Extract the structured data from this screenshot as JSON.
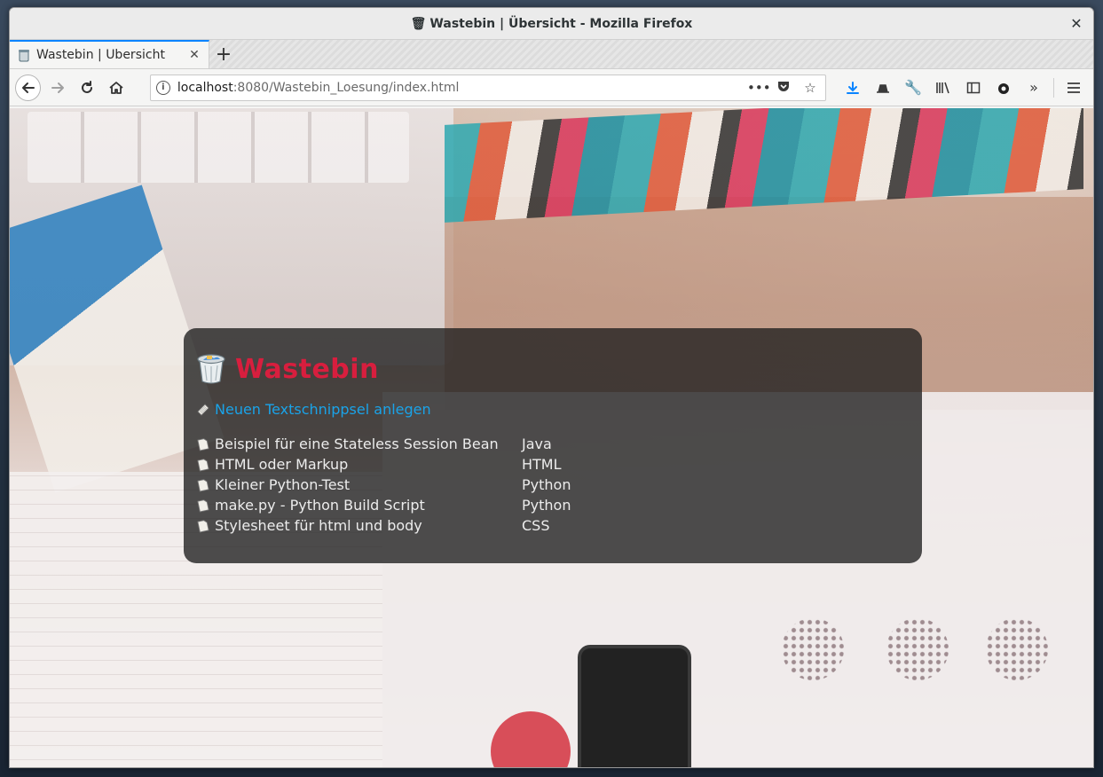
{
  "window": {
    "title": "Wastebin | Übersicht - Mozilla Firefox",
    "close_glyph": "✕"
  },
  "tabs": [
    {
      "label": "Wastebin | Übersicht",
      "active": true
    }
  ],
  "navbar": {
    "url_host": "localhost",
    "url_rest": ":8080/Wastebin_Loesung/index.html",
    "accent_color": "#0a84ff"
  },
  "page": {
    "title": "Wastebin",
    "title_color": "#d81e3e",
    "new_snippet_link": "Neuen Textschnippsel anlegen",
    "link_color": "#1aa3e8",
    "snippets": [
      {
        "name": "Beispiel für eine Stateless Session Bean",
        "language": "Java"
      },
      {
        "name": "HTML oder Markup",
        "language": "HTML"
      },
      {
        "name": "Kleiner Python-Test",
        "language": "Python"
      },
      {
        "name": "make.py - Python Build Script",
        "language": "Python"
      },
      {
        "name": "Stylesheet für html und body",
        "language": "CSS"
      }
    ]
  }
}
